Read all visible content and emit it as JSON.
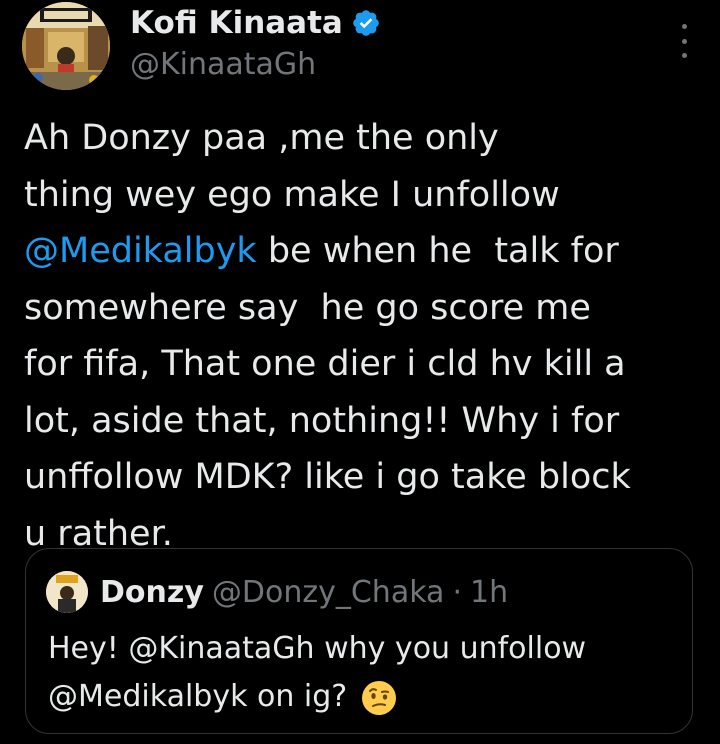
{
  "author": {
    "name": "Kofi Kinaata",
    "handle": "@KinaataGh",
    "avatar_icon": "avatar-image",
    "verified": true
  },
  "tweet": {
    "lines": [
      "Ah Donzy paa ,me the only",
      "thing wey ego make I unfollow",
      "be when he  talk for",
      "somewhere say  he go score me",
      "for fifa, That one dier i cld hv kill a",
      "lot, aside that, nothing!! Why i for",
      "unffollow MDK? like i go take block",
      "u rather."
    ],
    "mention": "@Medikalbyk"
  },
  "quoted": {
    "name": "Donzy",
    "handle": "@Donzy_Chaka",
    "separator": "·",
    "time": "1h",
    "line1_prefix": "Hey!",
    "line1_mention": "@KinaataGh",
    "line1_suffix": "why you unfollow",
    "line2_mention": "@Medikalbyk",
    "line2_suffix": "on ig?",
    "emoji_icon": "face-with-raised-eyebrow-icon"
  },
  "colors": {
    "background": "#000000",
    "text": "#e7e9ea",
    "secondary": "#71767b",
    "link": "#1d9bf0",
    "border": "#2f3336"
  }
}
